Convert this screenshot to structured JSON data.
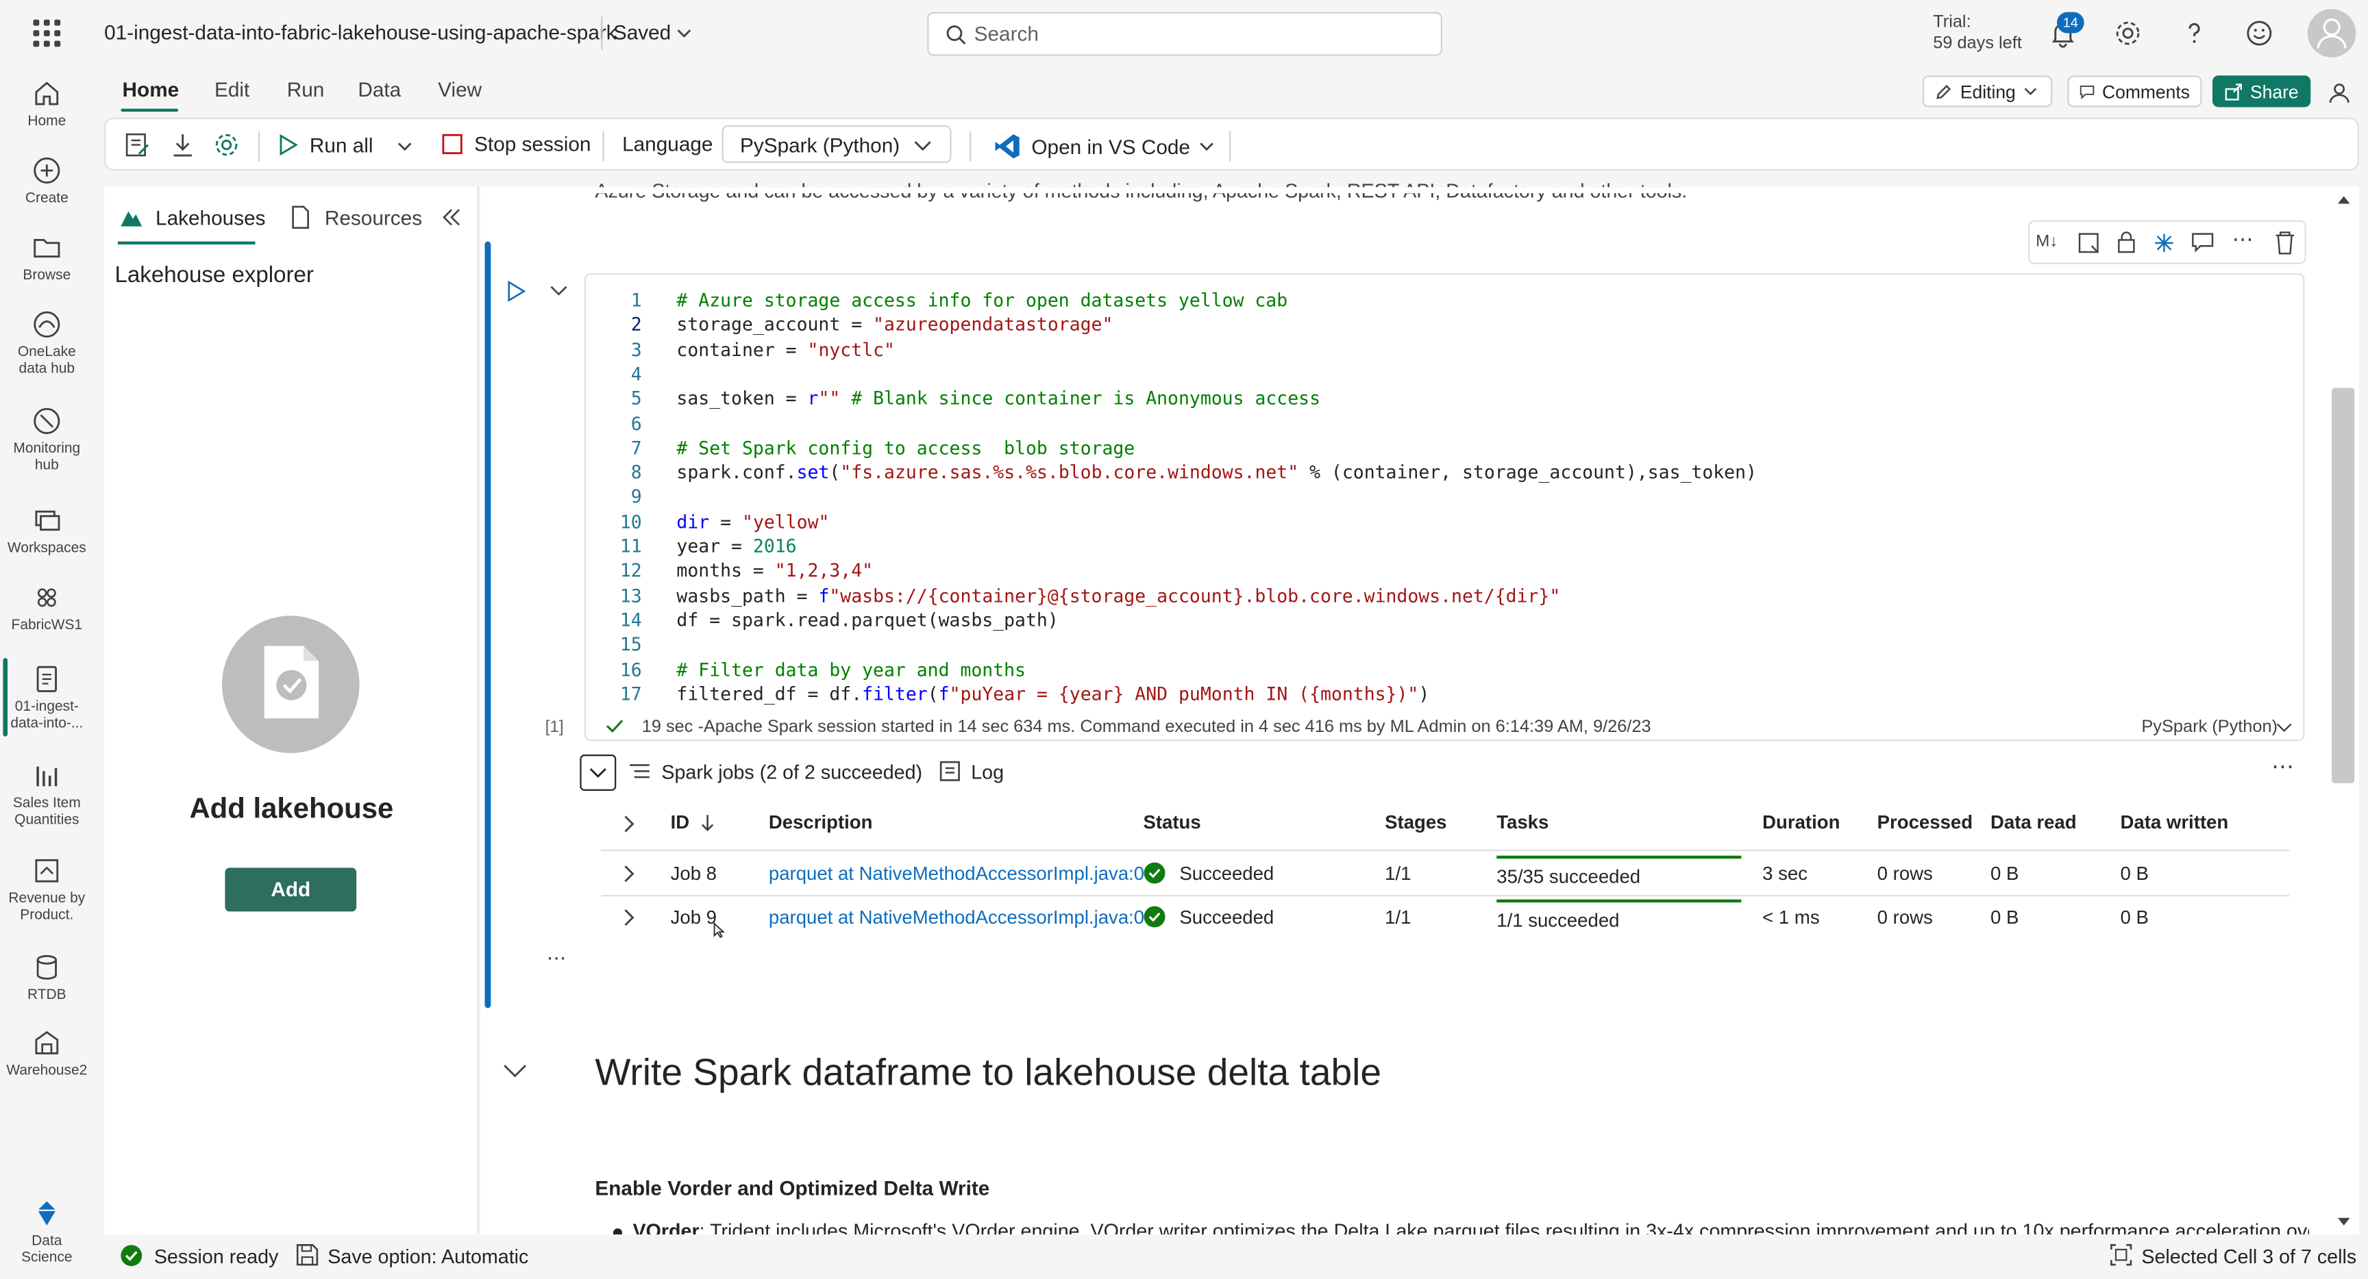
{
  "header": {
    "doc_title": "01-ingest-data-into-fabric-lakehouse-using-apache-spark",
    "save_state": "Saved",
    "search_placeholder": "Search",
    "trial_label": "Trial:",
    "trial_days": "59 days left",
    "notification_count": "14"
  },
  "rail": {
    "items": [
      {
        "label": "Home"
      },
      {
        "label": "Create"
      },
      {
        "label": "Browse"
      },
      {
        "label_1": "OneLake",
        "label_2": "data hub"
      },
      {
        "label_1": "Monitoring",
        "label_2": "hub"
      },
      {
        "label": "Workspaces"
      },
      {
        "label": "FabricWS1"
      },
      {
        "label_1": "01-ingest-",
        "label_2": "data-into-..."
      },
      {
        "label_1": "Sales Item",
        "label_2": "Quantities"
      },
      {
        "label_1": "Revenue by",
        "label_2": "Product."
      },
      {
        "label": "RTDB"
      },
      {
        "label": "Warehouse2"
      },
      {
        "label_1": "Data",
        "label_2": "Science"
      }
    ]
  },
  "ribbon": {
    "tabs": [
      "Home",
      "Edit",
      "Run",
      "Data",
      "View"
    ],
    "editing_label": "Editing",
    "comments_label": "Comments",
    "share_label": "Share"
  },
  "toolbar": {
    "run_all": "Run all",
    "stop_session": "Stop session",
    "language_label": "Language",
    "language_value": "PySpark (Python)",
    "open_vscode": "Open in VS Code"
  },
  "explorer": {
    "tab_lakehouses": "Lakehouses",
    "tab_resources": "Resources",
    "heading": "Lakehouse explorer",
    "add_title": "Add lakehouse",
    "add_button": "Add"
  },
  "notebook": {
    "intro_text": "Azure Storage and can be accessed by a variety of methods including, Apache Spark, REST API, Datafactory and other tools.",
    "cell_toolbar_md": "M↓",
    "code_lines": [
      "# Azure storage access info for open datasets yellow cab",
      "storage_account = \"azureopendatastorage\"",
      "container = \"nyctlc\"",
      "",
      "sas_token = r\"\" # Blank since container is Anonymous access",
      "",
      "# Set Spark config to access  blob storage",
      "spark.conf.set(\"fs.azure.sas.%s.%s.blob.core.windows.net\" % (container, storage_account),sas_token)",
      "",
      "dir = \"yellow\"",
      "year = 2016",
      "months = \"1,2,3,4\"",
      "wasbs_path = f\"wasbs://{container}@{storage_account}.blob.core.windows.net/{dir}\"",
      "df = spark.read.parquet(wasbs_path)",
      "",
      "# Filter data by year and months",
      "filtered_df = df.filter(f\"puYear = {year} AND puMonth IN ({months})\")"
    ],
    "line_numbers": [
      "1",
      "2",
      "3",
      "4",
      "5",
      "6",
      "7",
      "8",
      "9",
      "10",
      "11",
      "12",
      "13",
      "14",
      "15",
      "16",
      "17"
    ],
    "exec_count": "[1]",
    "exec_status": "19 sec -Apache Spark session started in 14 sec 634 ms. Command executed in 4 sec 416 ms by ML Admin on 6:14:39 AM, 9/26/23",
    "cell_language": "PySpark (Python)",
    "spark_jobs_label": "Spark jobs (2 of 2 succeeded)",
    "log_label": "Log",
    "jobs_columns": [
      "ID",
      "Description",
      "Status",
      "Stages",
      "Tasks",
      "Duration",
      "Processed",
      "Data read",
      "Data written"
    ],
    "jobs": [
      {
        "id": "Job 8",
        "description": "parquet at NativeMethodAccessorImpl.java:0",
        "status": "Succeeded",
        "stages": "1/1",
        "tasks": "35/35 succeeded",
        "tasks_progress": 1.0,
        "duration": "3 sec",
        "processed": "0 rows",
        "data_read": "0 B",
        "data_written": "0 B"
      },
      {
        "id": "Job 9",
        "description": "parquet at NativeMethodAccessorImpl.java:0",
        "status": "Succeeded",
        "stages": "1/1",
        "tasks": "1/1 succeeded",
        "tasks_progress": 1.0,
        "duration": "< 1 ms",
        "processed": "0 rows",
        "data_read": "0 B",
        "data_written": "0 B"
      }
    ],
    "section_heading": "Write Spark dataframe to lakehouse delta table",
    "subheading": "Enable Vorder and Optimized Delta Write",
    "bullet_term": "VOrder",
    "bullet_text": ": Trident includes Microsoft's VOrder engine. VOrder writer optimizes the Delta Lake parquet files resulting in 3x-4x compression improvement and up to 10x performance acceleration over"
  },
  "statusbar": {
    "session": "Session ready",
    "save_option": "Save option: Automatic",
    "selected_cell": "Selected Cell 3 of 7 cells"
  },
  "colors": {
    "accent": "#117865",
    "link": "#0f6cbd",
    "success": "#107c10"
  }
}
